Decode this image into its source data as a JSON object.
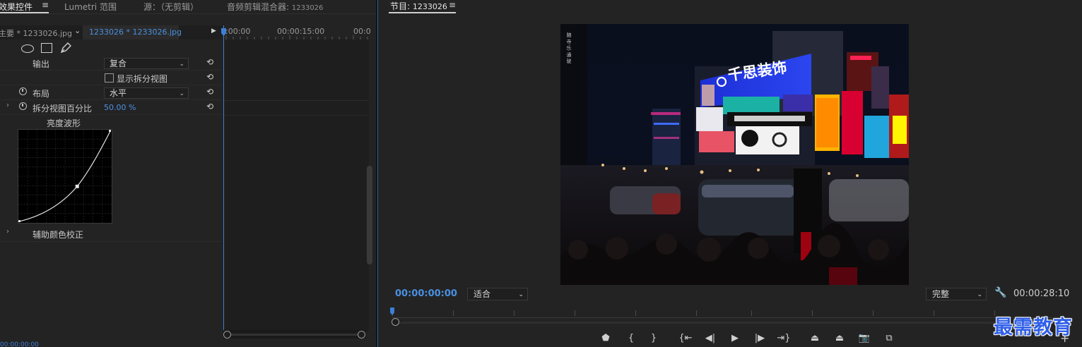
{
  "tabs": {
    "effect_controls": "效果控件",
    "lumetri": "Lumetri 范围",
    "source": "源：（无剪辑）",
    "mixer": "音频剪辑混合器:",
    "mixer_clip": "1233026"
  },
  "clip_bar": {
    "master": "主要 * 1233026.jpg",
    "selected": "1233026 * 1233026.jpg"
  },
  "timeline_ruler": {
    "start": ":00:00",
    "mid": "00:00:15:00",
    "end": "00:0"
  },
  "properties": {
    "output_label": "输出",
    "output_value": "复合",
    "split_view_label": "显示拆分视图",
    "layout_label": "布局",
    "layout_value": "水平",
    "split_percent_label": "拆分视图百分比",
    "split_percent_value": "50.00 %",
    "curve_title": "亮度波形",
    "aux_label": "辅助颜色校正"
  },
  "bottom_timecode": "00:00:00:00",
  "program": {
    "title": "节目:",
    "sequence": "1233026",
    "current_tc": "00:00:00:00",
    "fit": "适合",
    "quality": "完整",
    "duration_tc": "00:00:28:10"
  },
  "video_sign": {
    "headline": "千思装饰",
    "vertical": "随 寺 乐 通 驶"
  },
  "watermark": "最需教育",
  "colors": {
    "accent_blue": "#4a90e2",
    "panel_bg": "#232323",
    "playhead": "#3d7fd6"
  }
}
